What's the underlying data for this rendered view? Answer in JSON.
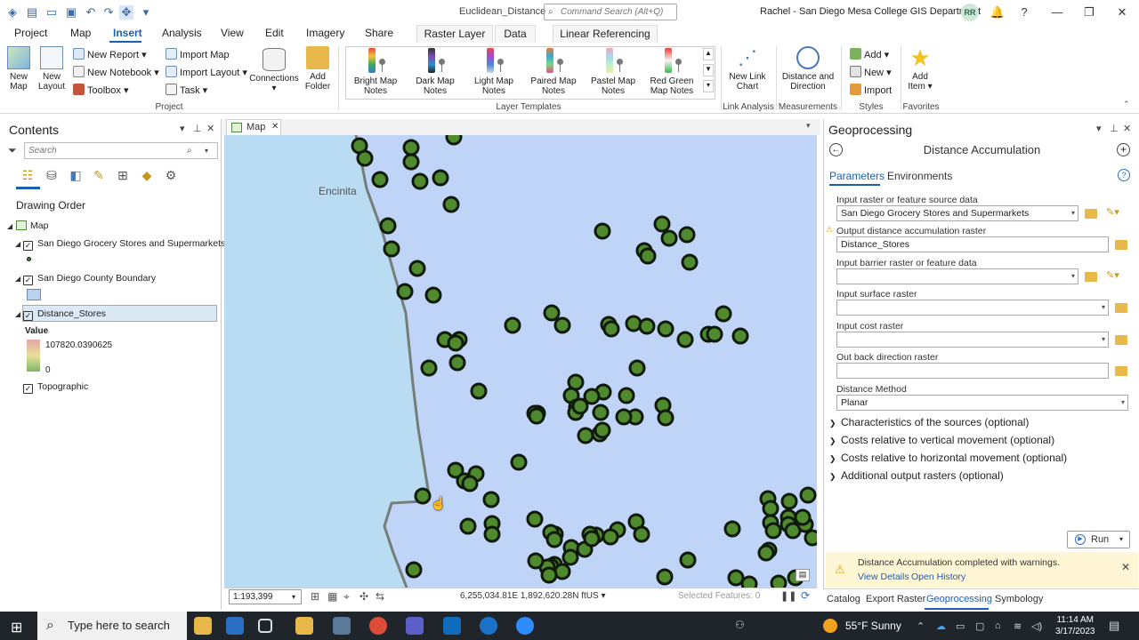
{
  "window": {
    "title": "Euclidean_Distance",
    "command_search_placeholder": "Command Search (Alt+Q)",
    "user": "Rachel - San Diego Mesa College GIS Department",
    "avatar_initials": "RR"
  },
  "ribbon": {
    "tabs": [
      "Project",
      "Map",
      "Insert",
      "Analysis",
      "View",
      "Edit",
      "Imagery",
      "Share"
    ],
    "active_tab": "Insert",
    "context_tabs": [
      "Raster Layer",
      "Data",
      "Linear Referencing"
    ],
    "project_group": {
      "new_map": "New Map",
      "new_layout": "New Layout",
      "new_report": "New Report",
      "new_notebook": "New Notebook",
      "toolbox": "Toolbox",
      "import_map": "Import Map",
      "import_layout": "Import Layout",
      "task": "Task",
      "connections": "Connections",
      "add_folder": "Add Folder",
      "label": "Project"
    },
    "layer_templates": {
      "items": [
        "Bright Map Notes",
        "Dark Map Notes",
        "Light Map Notes",
        "Paired Map Notes",
        "Pastel Map Notes",
        "Red Green Map Notes"
      ],
      "label": "Layer Templates"
    },
    "link_analysis": {
      "new_link_chart": "New Link Chart",
      "label": "Link Analysis"
    },
    "measurements": {
      "distance_direction": "Distance and Direction",
      "label": "Measurements"
    },
    "styles": {
      "add": "Add",
      "new": "New",
      "import": "Import",
      "label": "Styles"
    },
    "favorites": {
      "add_item": "Add Item",
      "label": "Favorites"
    }
  },
  "contents": {
    "title": "Contents",
    "search_placeholder": "Search",
    "drawing_order": "Drawing Order",
    "map_name": "Map",
    "layers": [
      {
        "name": "San Diego Grocery Stores and Supermarkets",
        "checked": true
      },
      {
        "name": "San Diego County Boundary",
        "checked": true
      },
      {
        "name": "Distance_Stores",
        "checked": true,
        "selected": true
      },
      {
        "name": "Topographic",
        "checked": true
      }
    ],
    "legend": {
      "title": "Value",
      "max": "107820.0390625",
      "min": "0"
    }
  },
  "map": {
    "tab_label": "Map",
    "place_label": "Encinita",
    "scale": "1:193,399",
    "coordinates": "6,255,034.81E 1,892,620.28N ftUS",
    "selected_features": "Selected Features: 0",
    "colors": {
      "ocean": "#b9dcf2",
      "land": "#c0d4f8",
      "point_fill": "#4f8a2f",
      "point_stroke": "#0f1a0c",
      "boundary": "#747d7a"
    }
  },
  "geoprocessing": {
    "title": "Geoprocessing",
    "tool": "Distance Accumulation",
    "tabs": [
      "Parameters",
      "Environments"
    ],
    "params": [
      {
        "label": "Input raster or feature source data",
        "value": "San Diego Grocery Stores and Supermarkets"
      },
      {
        "label": "Output distance accumulation raster",
        "value": "Distance_Stores"
      },
      {
        "label": "Input barrier raster or feature data",
        "value": ""
      },
      {
        "label": "Input surface raster",
        "value": ""
      },
      {
        "label": "Input cost raster",
        "value": ""
      },
      {
        "label": "Out back direction raster",
        "value": ""
      },
      {
        "label": "Distance Method",
        "value": "Planar"
      }
    ],
    "optional_sections": [
      "Characteristics of the sources (optional)",
      "Costs relative to vertical movement (optional)",
      "Costs relative to horizontal movement (optional)",
      "Additional output rasters (optional)"
    ],
    "run": "Run",
    "message": "Distance Accumulation completed with warnings.",
    "view_details": "View Details",
    "open_history": "Open History"
  },
  "bottom_tabs": [
    "Catalog",
    "Export Raster",
    "Geoprocessing",
    "Symbology"
  ],
  "taskbar": {
    "search_placeholder": "Type here to search",
    "weather": "55°F  Sunny",
    "time": "11:14 AM",
    "date": "3/17/2023"
  }
}
